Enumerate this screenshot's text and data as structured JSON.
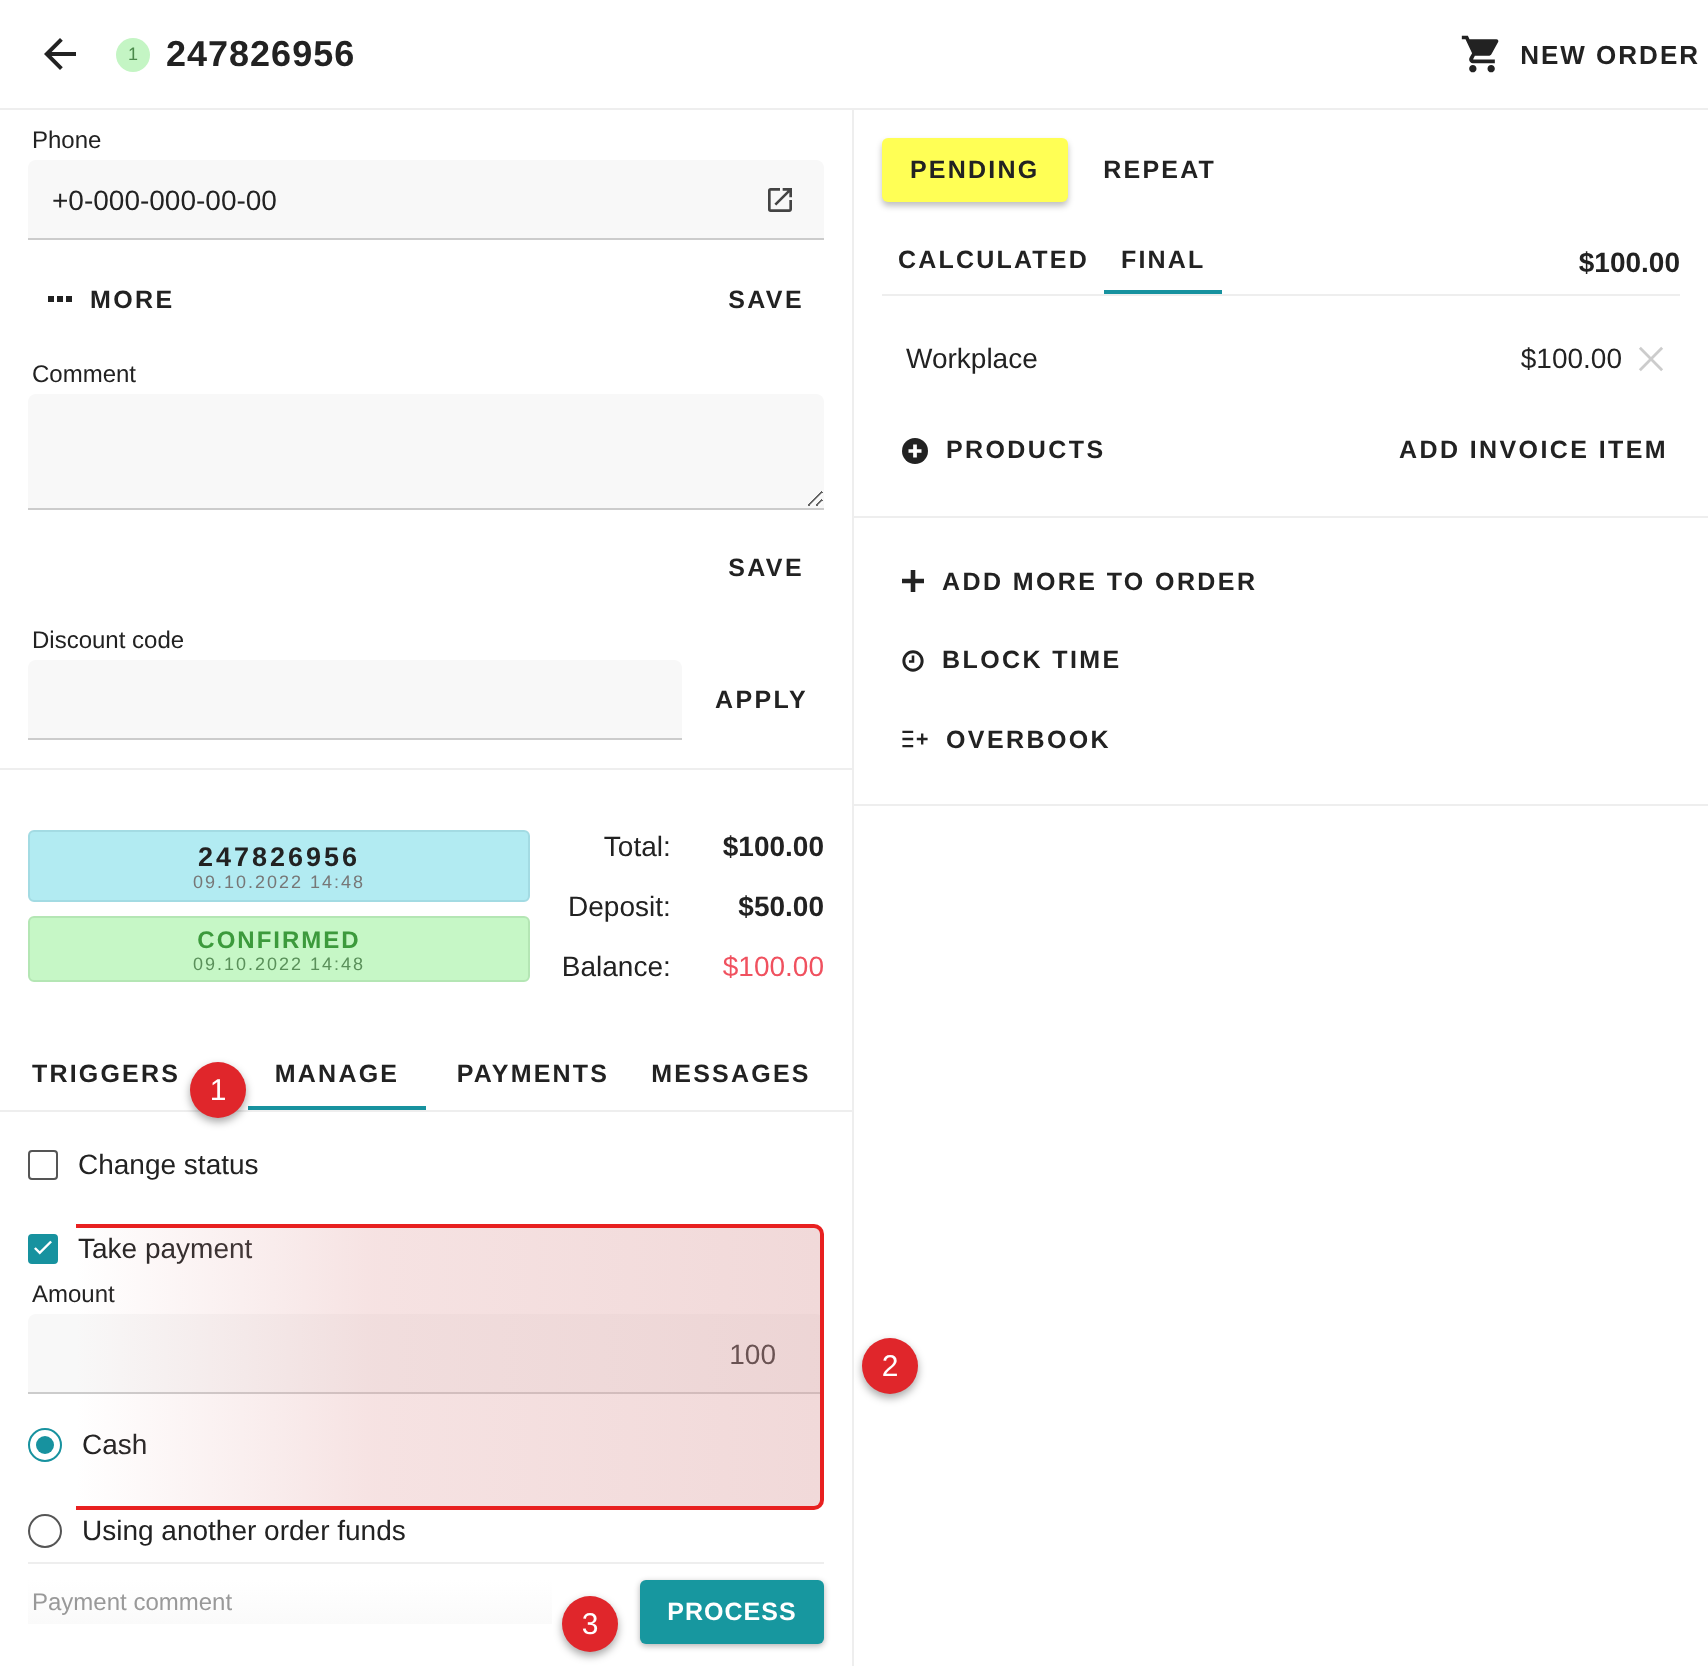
{
  "header": {
    "badge": "1",
    "title": "247826956",
    "new_order": "NEW ORDER"
  },
  "form": {
    "phone": {
      "label": "Phone",
      "value": "+0-000-000-00-00"
    },
    "more": "MORE",
    "save_more": "SAVE",
    "comment": {
      "label": "Comment"
    },
    "save_comment": "SAVE",
    "discount": {
      "label": "Discount code"
    },
    "apply": "APPLY"
  },
  "summary": {
    "order_card": {
      "number": "247826956",
      "date": "09.10.2022 14:48"
    },
    "status_card": {
      "status": "CONFIRMED",
      "date": "09.10.2022 14:48"
    },
    "totals": [
      {
        "label": "Total:",
        "value": "$100.00",
        "kind": "normal"
      },
      {
        "label": "Deposit:",
        "value": "$50.00",
        "kind": "normal"
      },
      {
        "label": "Balance:",
        "value": "$100.00",
        "kind": "alert"
      }
    ]
  },
  "tabs": [
    {
      "label": "TRIGGERS",
      "selected": false
    },
    {
      "label": "MANAGE",
      "selected": true
    },
    {
      "label": "PAYMENTS",
      "selected": false
    },
    {
      "label": "MESSAGES",
      "selected": false
    }
  ],
  "manage": {
    "change_status": {
      "label": "Change status",
      "checked": false
    },
    "take_payment": {
      "label": "Take payment",
      "checked": true
    },
    "amount": {
      "label": "Amount",
      "value": "100"
    },
    "methods": [
      {
        "label": "Cash",
        "selected": true
      },
      {
        "label": "Using another order funds",
        "selected": false
      }
    ],
    "payment_comment": {
      "placeholder": "Payment comment"
    },
    "process": "PROCESS"
  },
  "right": {
    "status_buttons": [
      {
        "label": "PENDING",
        "selected": true
      },
      {
        "label": "REPEAT",
        "selected": false
      }
    ],
    "price_tabs": [
      {
        "label": "CALCULATED",
        "selected": false
      },
      {
        "label": "FINAL",
        "selected": true
      }
    ],
    "price_total": "$100.00",
    "items": [
      {
        "name": "Workplace",
        "price": "$100.00"
      }
    ],
    "products": "PRODUCTS",
    "add_invoice_item": "ADD INVOICE ITEM",
    "actions": [
      {
        "label": "ADD MORE TO ORDER",
        "kind": "plus"
      },
      {
        "label": "BLOCK TIME",
        "kind": "clock"
      },
      {
        "label": "OVERBOOK",
        "kind": "overbook"
      }
    ]
  },
  "annotations": [
    {
      "label": "1"
    },
    {
      "label": "2"
    },
    {
      "label": "3"
    }
  ]
}
